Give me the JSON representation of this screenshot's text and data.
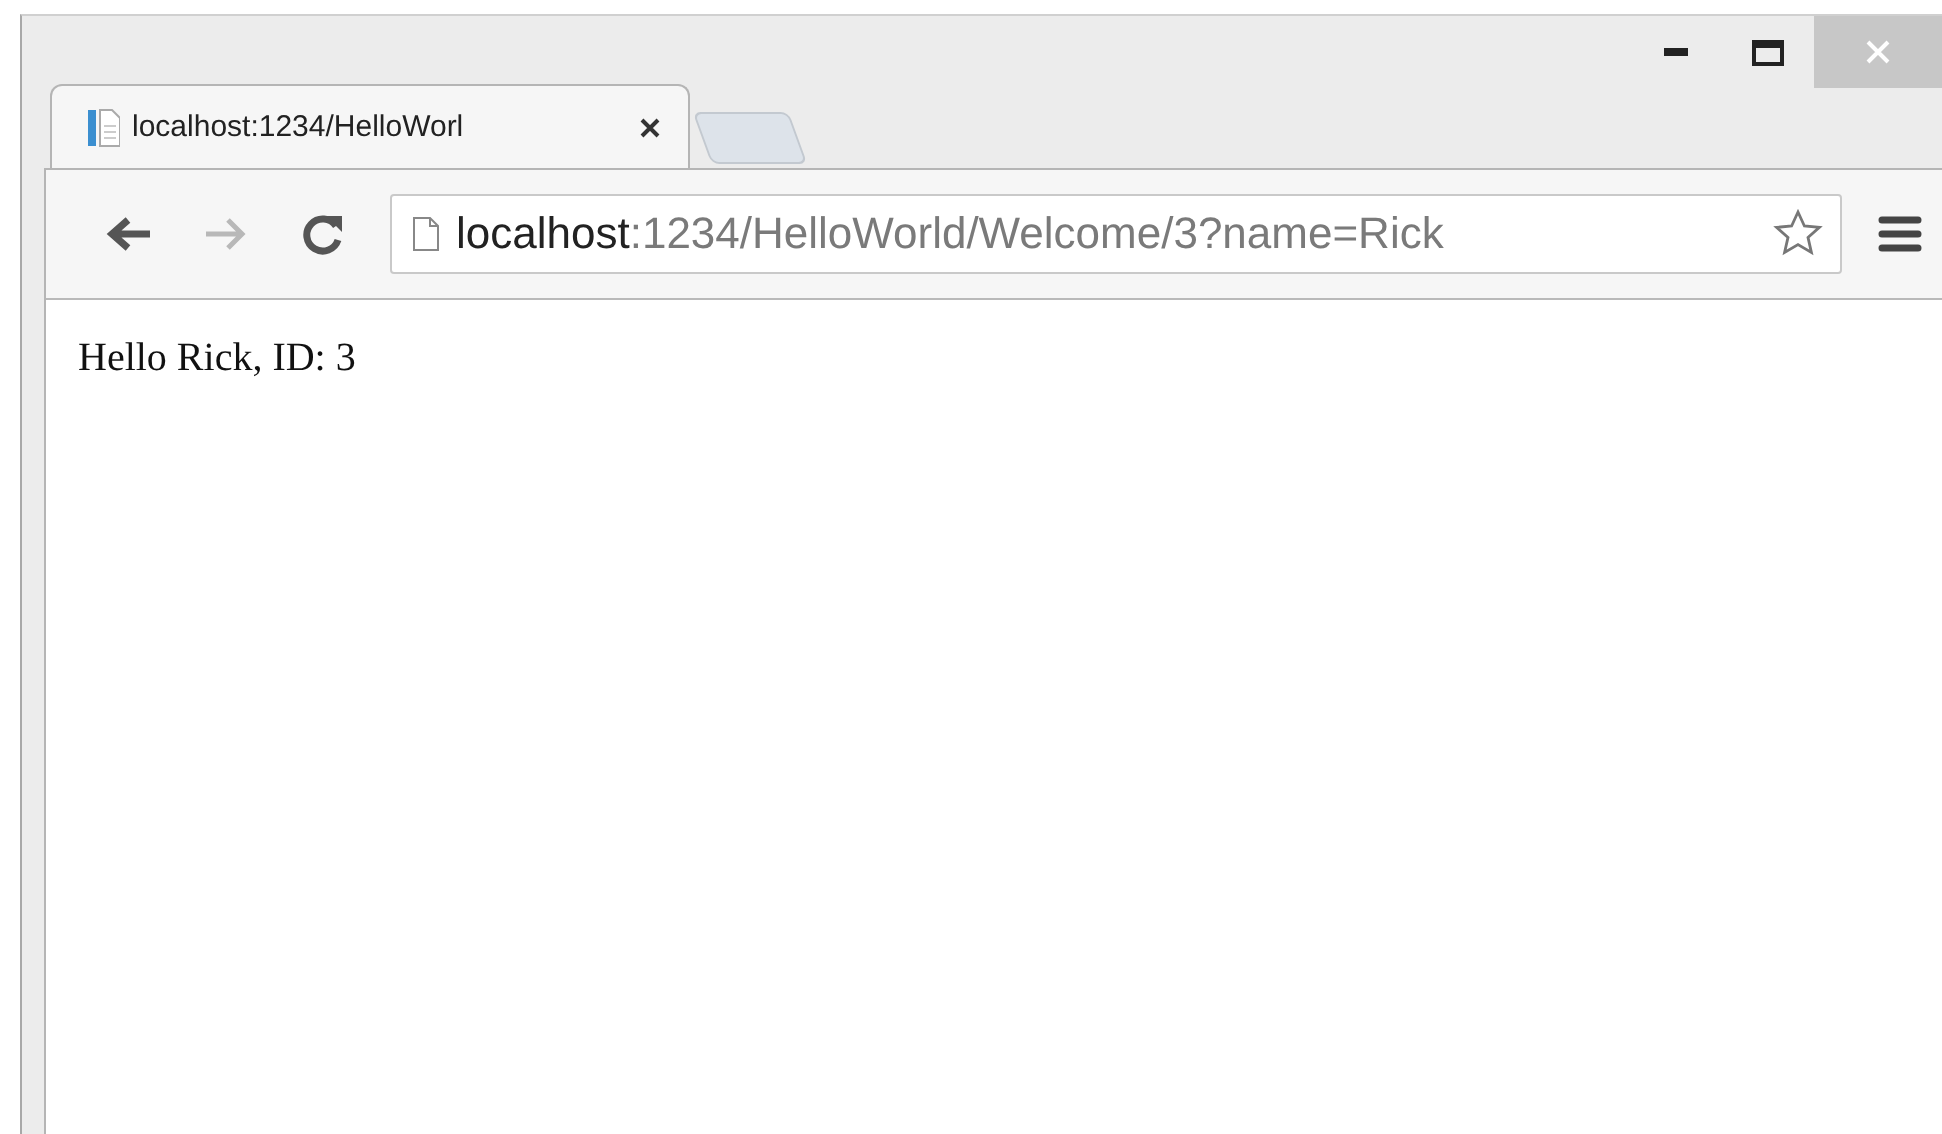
{
  "tabs": [
    {
      "title": "localhost:1234/HelloWorl",
      "selected": true
    }
  ],
  "toolbar": {
    "back_disabled": false,
    "forward_disabled": true
  },
  "address_bar": {
    "host": "localhost",
    "path": ":1234/HelloWorld/Welcome/3?name=Rick"
  },
  "page": {
    "text": "Hello Rick, ID: 3"
  }
}
